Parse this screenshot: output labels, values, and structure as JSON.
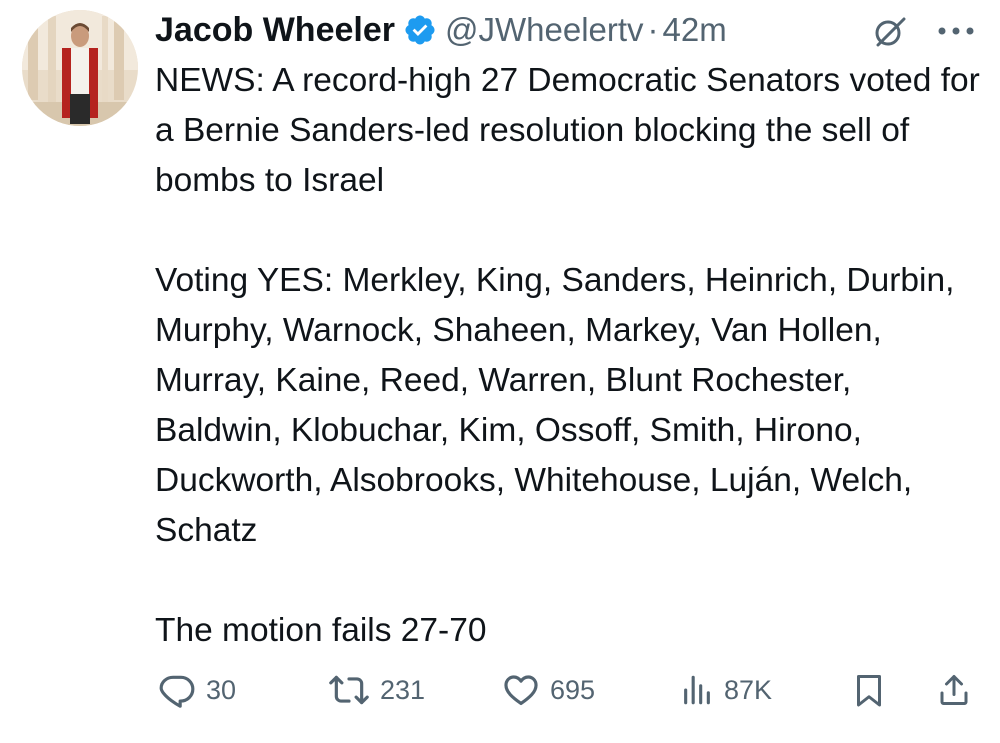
{
  "author": {
    "name": "Jacob Wheeler",
    "handle": "@JWheelertv",
    "separator": "·",
    "time": "42m",
    "verified": true
  },
  "tweet": {
    "paragraphs": [
      "NEWS: A record-high 27 Democratic Senators voted for a Bernie Sanders-led resolution blocking the sell of bombs to Israel",
      "Voting YES: Merkley, King, Sanders, Heinrich, Durbin, Murphy, Warnock, Shaheen, Markey, Van Hollen, Murray, Kaine, Reed, Warren, Blunt Rochester, Baldwin, Klobuchar, Kim, Ossoff, Smith, Hirono, Duckworth, Alsobrooks, Whitehouse, Luján, Welch, Schatz",
      "The motion fails 27-70"
    ]
  },
  "actions": {
    "replies": "30",
    "reposts": "231",
    "likes": "695",
    "views": "87K"
  },
  "icons": {
    "verified": "verified-badge-icon",
    "grok": "grok-icon",
    "more": "more-icon",
    "reply": "reply-icon",
    "repost": "repost-icon",
    "like": "heart-icon",
    "views": "views-icon",
    "bookmark": "bookmark-icon",
    "share": "share-icon"
  },
  "colors": {
    "text": "#0f1419",
    "secondary": "#536471",
    "verified": "#1d9bf0"
  }
}
